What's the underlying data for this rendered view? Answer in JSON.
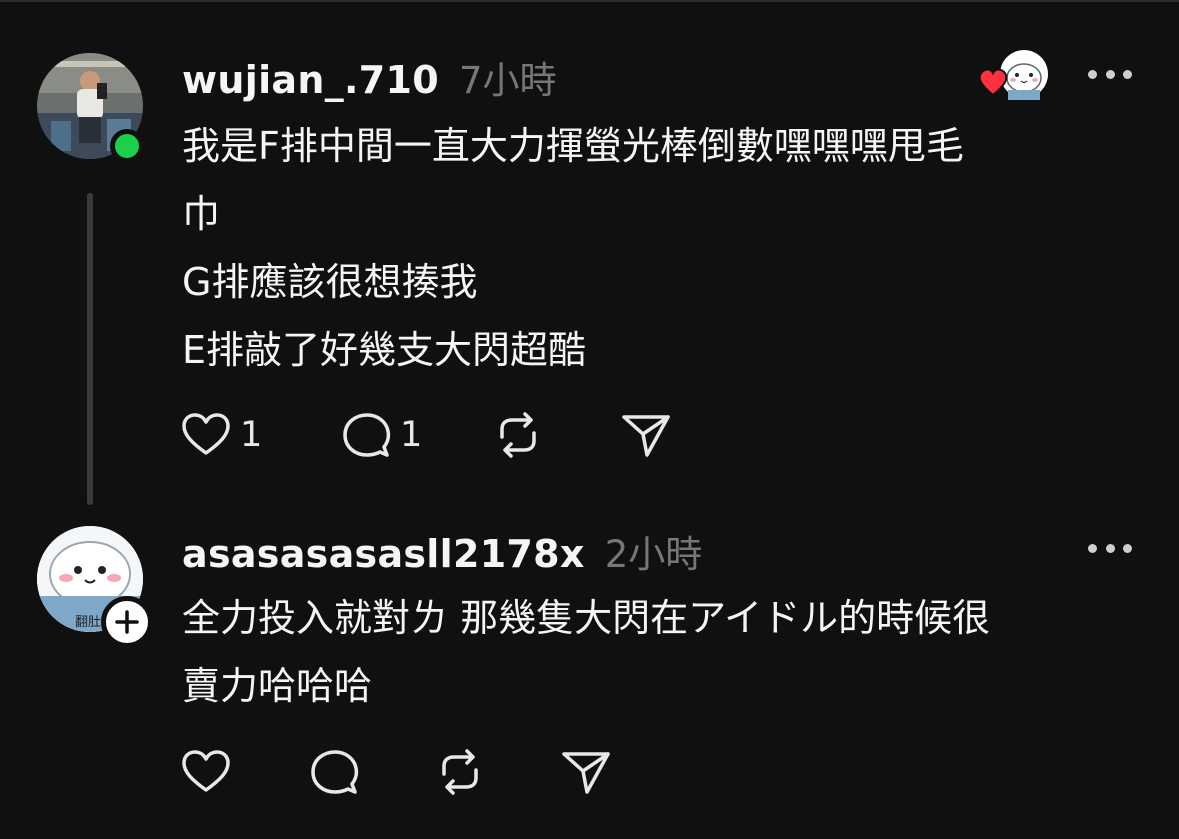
{
  "posts": [
    {
      "username": "wujian_.710",
      "time": "7小時",
      "avatar_icon": "profile-photo",
      "status": "online",
      "liked_by_author": true,
      "lines": [
        "我是F排中間一直大力揮螢光棒倒數嘿嘿嘿甩毛",
        "巾",
        "G排應該很想揍我",
        "E排敲了好幾支大閃超酷"
      ],
      "likes": "1",
      "replies": "1"
    },
    {
      "username": "asasasasasll2178x",
      "time": "2小時",
      "avatar_icon": "chiikawa-avatar",
      "avatar_caption": "翻肚",
      "follow_badge": "+",
      "lines": [
        "全力投入就對ㄌ 那幾隻大閃在アイドル的時候很",
        "賣力哈哈哈"
      ]
    }
  ],
  "colors": {
    "background": "#101010",
    "text": "#f3f5f7",
    "muted": "#777777",
    "online": "#1bd04b",
    "heart": "#ff3040"
  }
}
